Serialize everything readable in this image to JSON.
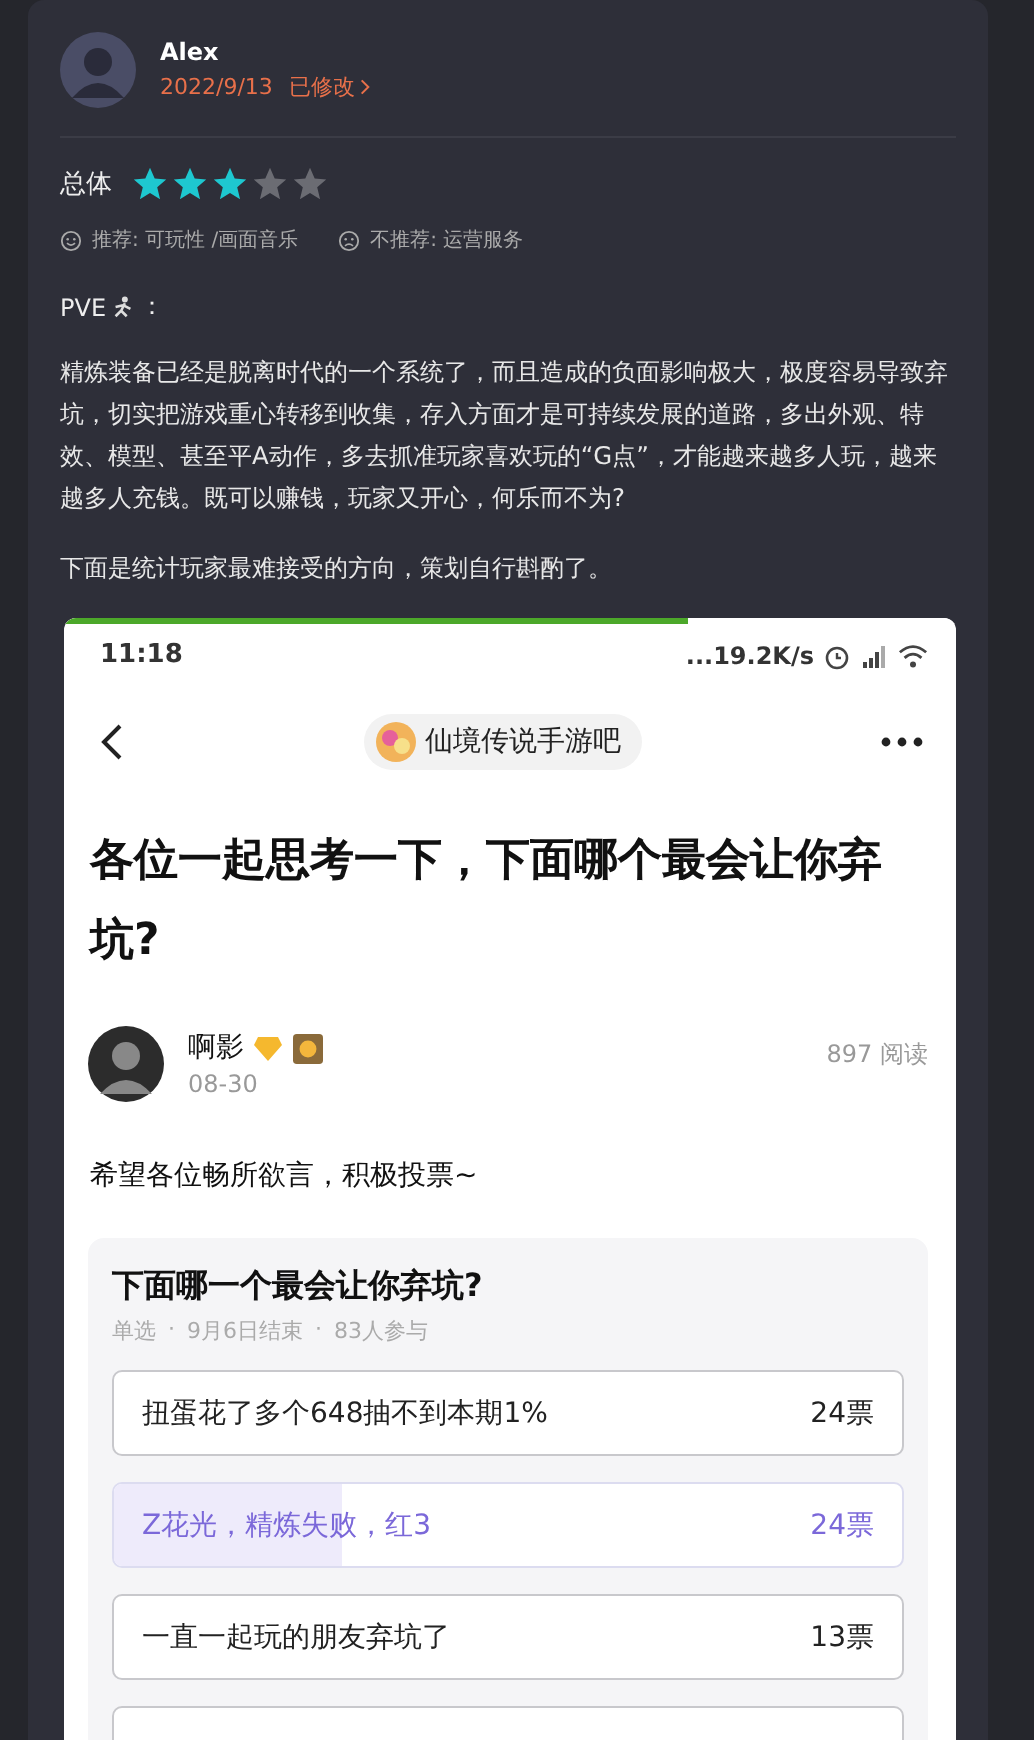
{
  "review": {
    "author": "Alex",
    "date": "2022/9/13",
    "edited": "已修改",
    "rating_label": "总体",
    "stars": 3,
    "tags": [
      {
        "kind": "good",
        "text": "推荐: 可玩性 /画面音乐"
      },
      {
        "kind": "bad",
        "text": "不推荐: 运营服务"
      }
    ],
    "heading_prefix": "PVE",
    "heading_suffix": "：",
    "paragraphs": [
      "精炼装备已经是脱离时代的一个系统了，而且造成的负面影响极大，极度容易导致弃坑，切实把游戏重心转移到收集，存入方面才是可持续发展的道路，多出外观、特效、模型、甚至平A动作，多去抓准玩家喜欢玩的“G点”，才能越来越多人玩，越来越多人充钱。既可以赚钱，玩家又开心，何乐而不为?",
      "下面是统计玩家最难接受的方向，策划自行斟酌了。"
    ]
  },
  "screenshot": {
    "load_bar": {
      "level": 0.7
    },
    "time": "11:18",
    "net_speed": "...19.2K/s",
    "forum": "仙境传说手游吧",
    "title": "各位一起思考一下，下面哪个最会让你弃坑?",
    "poster": {
      "name": "啊影",
      "date": "08-30",
      "views": "897 阅读"
    },
    "body": "希望各位畅所欲言，积极投票~",
    "poll": {
      "title": "下面哪一个最会让你弃坑?",
      "meta": [
        "单选",
        "9月6日结束",
        "83人参与"
      ],
      "meta_separator": "·",
      "options": [
        {
          "text": "扭蛋花了多个648抽不到本期1%",
          "votes": "24票",
          "selected": false
        },
        {
          "text": "Z花光，精炼失败，红3",
          "votes": "24票",
          "selected": true,
          "level": 0.29
        },
        {
          "text": "一直一起玩的朋友弃坑了",
          "votes": "13票",
          "selected": false
        }
      ]
    }
  }
}
